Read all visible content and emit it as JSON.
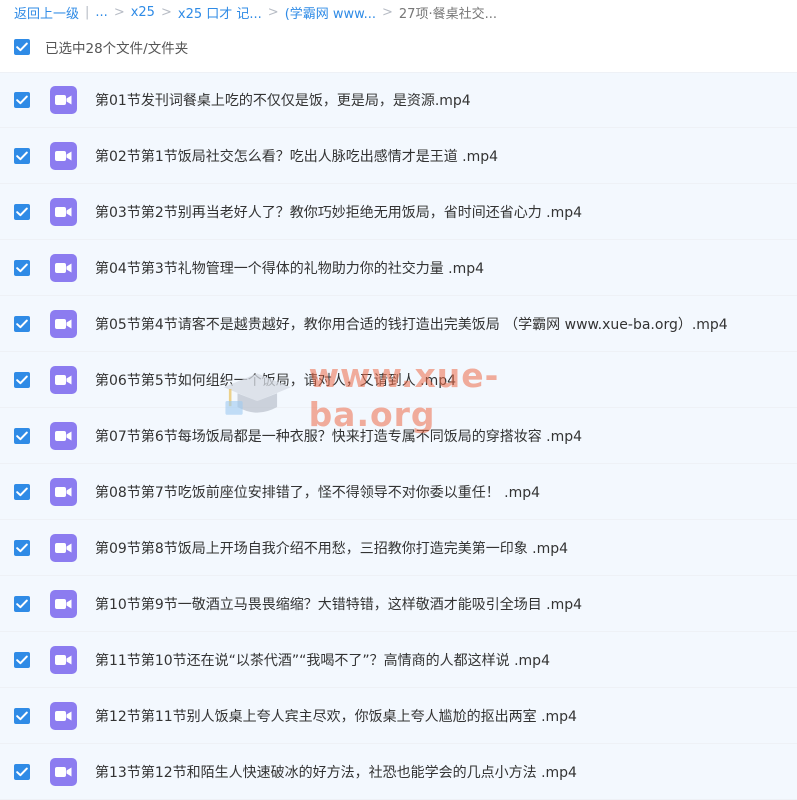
{
  "breadcrumb": {
    "back": "返回上一级",
    "crumbs": [
      "...",
      "x25",
      "x25 口才 记...",
      "(学霸网 www...",
      "27项·餐桌社交..."
    ]
  },
  "selection": {
    "label": "已选中28个文件/文件夹",
    "checked": true
  },
  "colors": {
    "accent": "#2f8be6",
    "row_bg": "#f3f8fe",
    "video_icon": "#8c7cf0",
    "watermark": "#ed6c48"
  },
  "watermark": {
    "text": "www.xue-ba.org"
  },
  "files": [
    {
      "name": "第01节发刊词餐桌上吃的不仅仅是饭，更是局，是资源.mp4",
      "checked": true,
      "icon": "video-file-icon"
    },
    {
      "name": "第02节第1节饭局社交怎么看？吃出人脉吃出感情才是王道 .mp4",
      "checked": true,
      "icon": "video-file-icon"
    },
    {
      "name": "第03节第2节别再当老好人了？教你巧妙拒绝无用饭局，省时间还省心力 .mp4",
      "checked": true,
      "icon": "video-file-icon"
    },
    {
      "name": "第04节第3节礼物管理一个得体的礼物助力你的社交力量 .mp4",
      "checked": true,
      "icon": "video-file-icon"
    },
    {
      "name": "第05节第4节请客不是越贵越好，教你用合适的钱打造出完美饭局 （学霸网 www.xue-ba.org）.mp4",
      "checked": true,
      "icon": "video-file-icon"
    },
    {
      "name": "第06节第5节如何组织一个饭局，请对人，又请到人 .mp4",
      "checked": true,
      "icon": "video-file-icon"
    },
    {
      "name": "第07节第6节每场饭局都是一种衣服？快来打造专属不同饭局的穿搭妆容 .mp4",
      "checked": true,
      "icon": "video-file-icon"
    },
    {
      "name": "第08节第7节吃饭前座位安排错了，怪不得领导不对你委以重任！ .mp4",
      "checked": true,
      "icon": "video-file-icon"
    },
    {
      "name": "第09节第8节饭局上开场自我介绍不用愁，三招教你打造完美第一印象 .mp4",
      "checked": true,
      "icon": "video-file-icon"
    },
    {
      "name": "第10节第9节一敬酒立马畏畏缩缩？大错特错，这样敬酒才能吸引全场目 .mp4",
      "checked": true,
      "icon": "video-file-icon"
    },
    {
      "name": "第11节第10节还在说“以茶代酒”“我喝不了”？高情商的人都这样说 .mp4",
      "checked": true,
      "icon": "video-file-icon"
    },
    {
      "name": "第12节第11节别人饭桌上夸人宾主尽欢，你饭桌上夸人尴尬的抠出两室 .mp4",
      "checked": true,
      "icon": "video-file-icon"
    },
    {
      "name": "第13节第12节和陌生人快速破冰的好方法，社恐也能学会的几点小方法 .mp4",
      "checked": true,
      "icon": "video-file-icon"
    }
  ]
}
